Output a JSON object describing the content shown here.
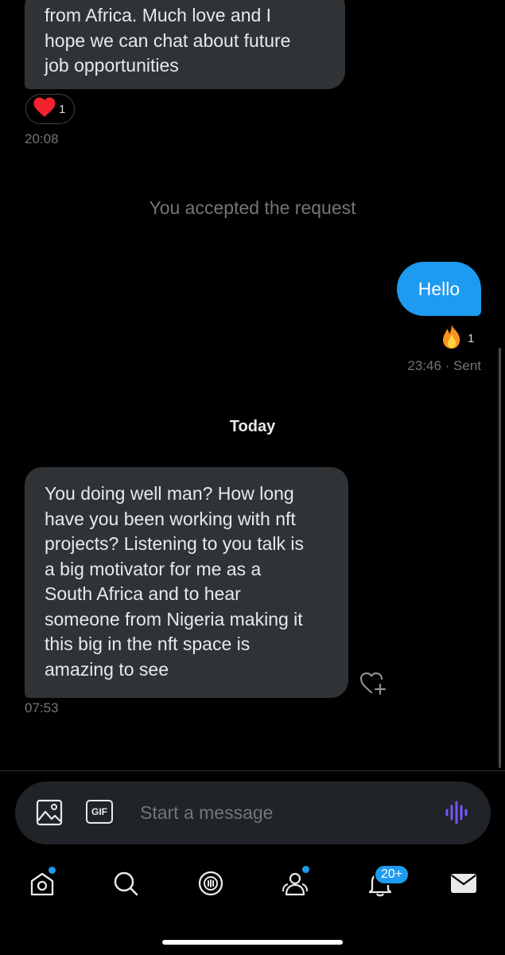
{
  "messages": {
    "top_bubble": {
      "lines": [
        "from Africa. Much love and I",
        "hope we can chat about future",
        "job opportunities"
      ],
      "reaction_count": "1",
      "time": "20:08"
    },
    "system_text": "You accepted the request",
    "outgoing": {
      "text": "Hello",
      "reaction_count": "1",
      "time": "23:46",
      "status": "· Sent"
    },
    "date_divider": "Today",
    "incoming": {
      "lines": [
        "You doing well man? How long",
        "have you been working with nft",
        "projects? Listening to you talk is",
        "a big motivator for me as a",
        "South Africa and to hear",
        "someone from Nigeria making it",
        "this big in the nft space is",
        "amazing to see"
      ],
      "time": "07:53"
    }
  },
  "composer": {
    "placeholder": "Start a message",
    "gif_label": "GIF"
  },
  "bottom_nav": {
    "notifications_badge": "20+"
  },
  "colors": {
    "accent": "#1d9bf0",
    "bubble_incoming": "#2f3336",
    "muted_text": "#71767b",
    "heart": "#f91880"
  }
}
